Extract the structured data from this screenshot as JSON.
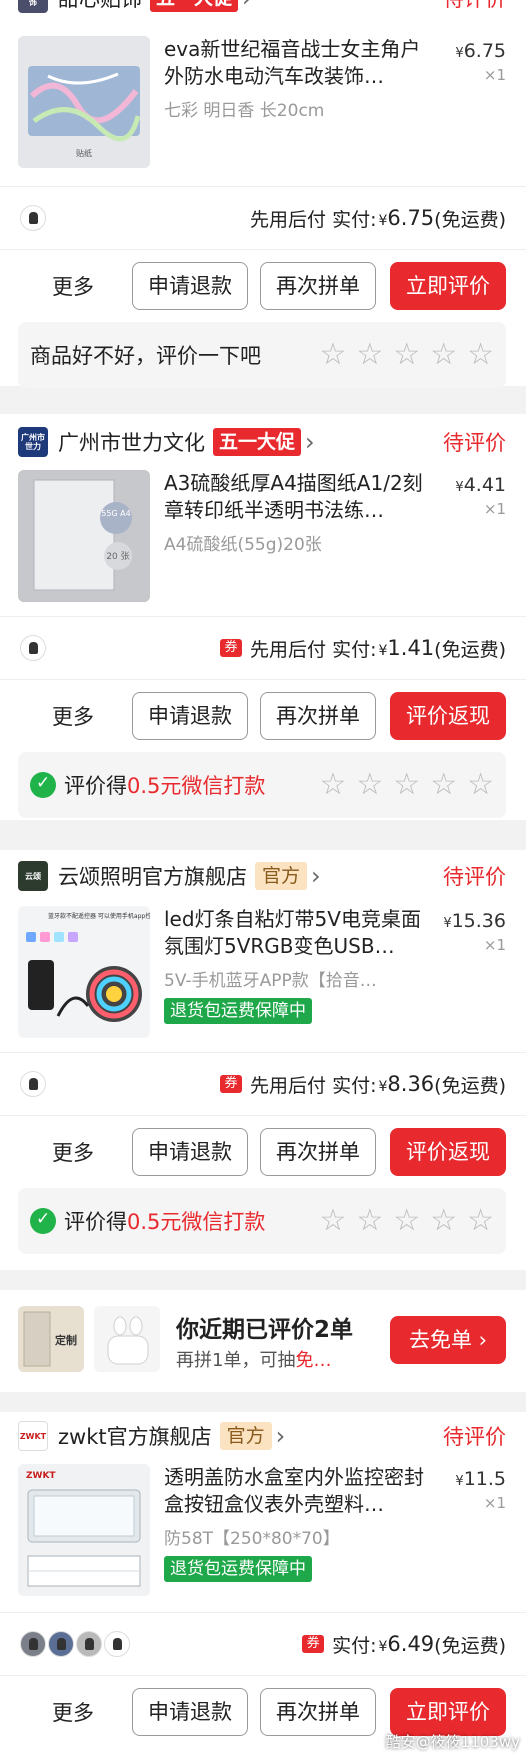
{
  "orders": [
    {
      "shop_name": "甜心贴饰",
      "shop_logo_text": "甜心贴饰",
      "badge": "五一大促",
      "status": "待评价",
      "product": {
        "title": "eva新世纪福音战士女主角户外防水电动汽车改装饰…",
        "spec": "七彩 明日香 长20cm",
        "price": "6.75",
        "qty": "×1",
        "image_caption": "贴纸"
      },
      "pay": {
        "text": "先用后付 实付:",
        "amount": "6.75",
        "shipping": "(免运费)"
      },
      "more": "更多",
      "buttons": [
        "申请退款",
        "再次拼单",
        "立即评价"
      ],
      "review_text": "商品好不好，评价一下吧"
    },
    {
      "shop_name": "广州市世力文化",
      "shop_logo_text": "广州市世力",
      "badge": "五一大促",
      "status": "待评价",
      "product": {
        "title": "A3硫酸纸厚A4描图纸A1/2刻章转印纸半透明书法练…",
        "spec": "A4硫酸纸(55g)20张",
        "price": "4.41",
        "qty": "×1",
        "image_caption_1": "55G A4",
        "image_caption_2": "20 张"
      },
      "pay": {
        "coupon": "券",
        "text": "先用后付 实付:",
        "amount": "1.41",
        "shipping": "(免运费)"
      },
      "more": "更多",
      "buttons": [
        "申请退款",
        "再次拼单",
        "评价返现"
      ],
      "review_prefix": "评价得",
      "review_highlight": "0.5元微信打款"
    },
    {
      "shop_name": "云颂照明官方旗舰店",
      "shop_logo_text": "云颂",
      "badge": "官方",
      "status": "待评价",
      "product": {
        "title": "led灯条自粘灯带5V电竞桌面氛围灯5VRGB变色USB…",
        "spec": "5V-手机蓝牙APP款【拾音…",
        "price": "15.36",
        "qty": "×1",
        "guarantee": "退货包运费保障中",
        "image_caption": "蓝牙款不配遥控器 可以使用手机app控制"
      },
      "pay": {
        "coupon": "券",
        "text": "先用后付 实付:",
        "amount": "8.36",
        "shipping": "(免运费)"
      },
      "more": "更多",
      "buttons": [
        "申请退款",
        "再次拼单",
        "评价返现"
      ],
      "review_prefix": "评价得",
      "review_highlight": "0.5元微信打款"
    },
    {
      "shop_name": "zwkt官方旗舰店",
      "shop_logo_text": "ZWKT",
      "badge": "官方",
      "status": "待评价",
      "product": {
        "title": "透明盖防水盒室内外监控密封盒按钮盒仪表外壳塑料…",
        "spec": "防58T【250*80*70】",
        "price": "11.5",
        "qty": "×1",
        "guarantee": "退货包运费保障中",
        "image_caption": "ZWKT"
      },
      "pay": {
        "coupon": "券",
        "text": "实付:",
        "amount": "6.49",
        "shipping": "(免运费)"
      },
      "more": "更多",
      "buttons": [
        "申请退款",
        "再次拼单",
        "立即评价"
      ]
    }
  ],
  "banner": {
    "title": "你近期已评价2单",
    "sub_prefix": "再拼1单，可抽",
    "sub_highlight": "免…",
    "button": "去免单",
    "thumb_caption": "定制"
  },
  "currency": "¥",
  "star_glyph": "☆",
  "watermark": "酷安@筱筱1103wy",
  "colors": {
    "accent": "#e8292d",
    "green": "#1fa84a",
    "official_bg": "#fbe3c2"
  }
}
